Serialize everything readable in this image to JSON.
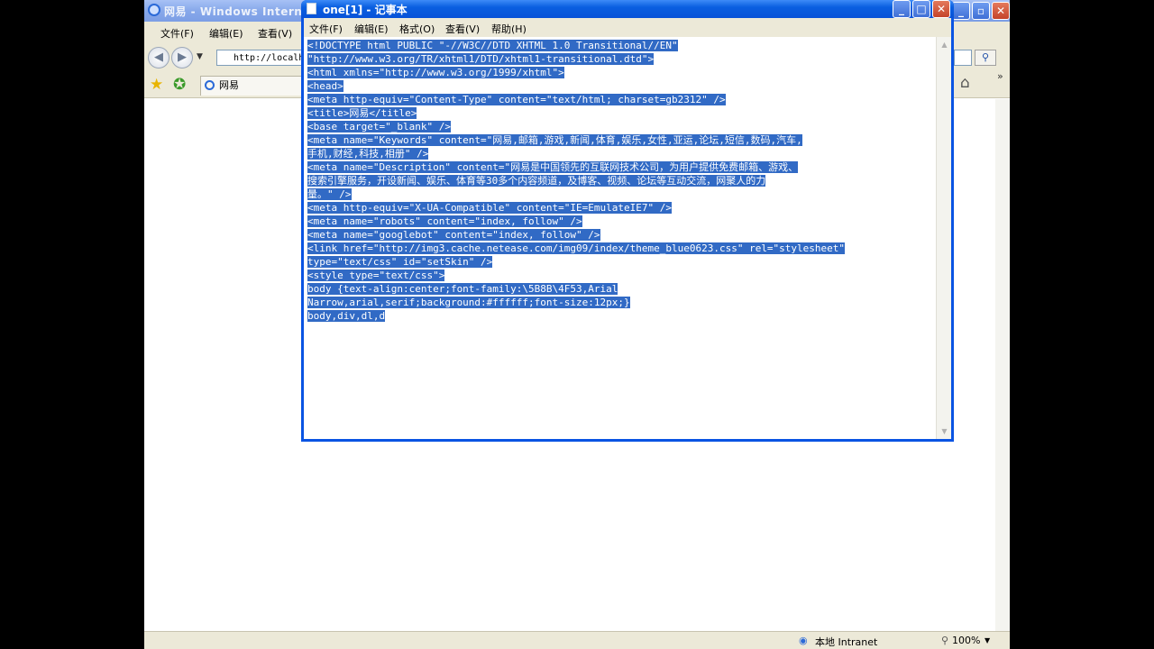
{
  "ie": {
    "title": "网易 - Windows Internet",
    "menus": [
      "文件(F)",
      "编辑(E)",
      "查看(V)"
    ],
    "address": "http://localh",
    "tab_label": "网易",
    "status_zone": "本地 Intranet",
    "zoom": "100%"
  },
  "notepad": {
    "title": "one[1] - 记事本",
    "menus": [
      "文件(F)",
      "编辑(E)",
      "格式(O)",
      "查看(V)",
      "帮助(H)"
    ],
    "lines": [
      "<!DOCTYPE html PUBLIC \"-//W3C//DTD XHTML 1.0 Transitional//EN\"",
      "\"http://www.w3.org/TR/xhtml1/DTD/xhtml1-transitional.dtd\">",
      "<html xmlns=\"http://www.w3.org/1999/xhtml\">",
      "<head>",
      "<meta http-equiv=\"Content-Type\" content=\"text/html; charset=gb2312\" />",
      "<title>网易</title>",
      "<base target=\"_blank\" />",
      "<meta name=\"Keywords\" content=\"网易,邮箱,游戏,新闻,体育,娱乐,女性,亚运,论坛,短信,数码,汽车,",
      "手机,财经,科技,相册\" />",
      "<meta name=\"Description\" content=\"网易是中国领先的互联网技术公司，为用户提供免费邮箱、游戏、",
      "搜索引擎服务，开设新闻、娱乐、体育等30多个内容频道，及博客、视频、论坛等互动交流，网聚人的力",
      "量。\" />",
      "<meta http-equiv=\"X-UA-Compatible\" content=\"IE=EmulateIE7\" />",
      "<meta name=\"robots\" content=\"index, follow\" />",
      "<meta name=\"googlebot\" content=\"index, follow\" />",
      "<link href=\"http://img3.cache.netease.com/img09/index/theme_blue0623.css\" rel=\"stylesheet\"",
      "type=\"text/css\" id=\"setSkin\" />",
      "<style type=\"text/css\">",
      "body {text-align:center;font-family:\\5B8B\\4F53,Arial",
      "Narrow,arial,serif;background:#ffffff;font-size:12px;}",
      "body,div,dl,d"
    ]
  }
}
